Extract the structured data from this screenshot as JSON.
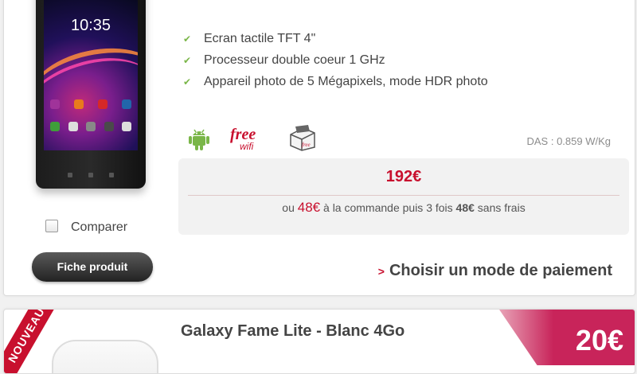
{
  "product1": {
    "features": [
      "Ecran tactile TFT 4\"",
      "Processeur double coeur 1 GHz",
      "Appareil photo de 5 Mégapixels, mode HDR photo"
    ],
    "phone_clock": "10:35",
    "free_logo_text": "free",
    "free_logo_sub": "wifi",
    "das": "DAS : 0.859 W/Kg",
    "price": "192€",
    "installment": {
      "prefix": "ou",
      "first_amount": "48€",
      "middle": "à la commande puis 3 fois",
      "second_amount": "48€",
      "suffix": "sans frais"
    },
    "compare_label": "Comparer",
    "fiche_button": "Fiche produit",
    "pay_link": "Choisir un mode de paiement"
  },
  "product2": {
    "badge": "NOUVEAU",
    "title": "Galaxy Fame Lite - Blanc 4Go",
    "price": "20€"
  },
  "colors": {
    "accent_red": "#c8102e",
    "check_green": "#7ab648",
    "price_tag_pink": "#c8245a"
  }
}
